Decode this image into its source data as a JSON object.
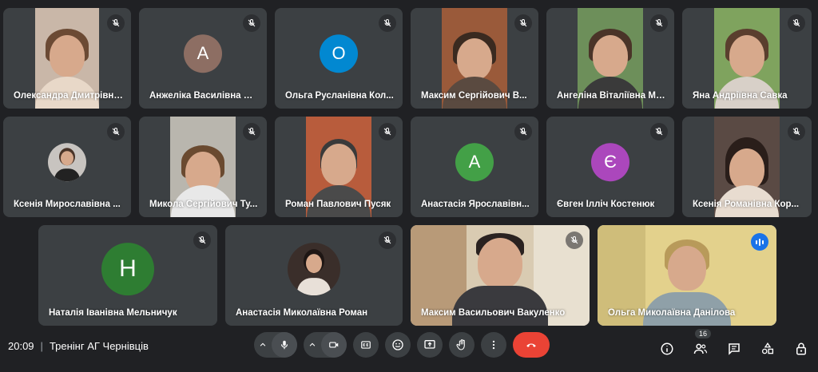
{
  "meeting": {
    "time": "20:09",
    "title": "Тренінг АГ Чернівців"
  },
  "participant_count": "16",
  "participants": [
    {
      "name": "Олександра Дмитрівна...",
      "type": "video",
      "muted": true
    },
    {
      "name": "Анжеліка Василівна Ш...",
      "type": "avatar",
      "initial": "А",
      "color": "#8d6e63",
      "muted": true
    },
    {
      "name": "Ольга Русланівна Кол...",
      "type": "avatar",
      "initial": "О",
      "color": "#0288d1",
      "muted": true
    },
    {
      "name": "Максим Сергійович В...",
      "type": "video",
      "muted": true
    },
    {
      "name": "Ангеліна Віталіївна Ма...",
      "type": "video",
      "muted": true
    },
    {
      "name": "Яна Андріївна Савка",
      "type": "video",
      "muted": true
    },
    {
      "name": "Ксенія Мирославівна ...",
      "type": "photo",
      "muted": true
    },
    {
      "name": "Микола Сергійович Ту...",
      "type": "video",
      "muted": true
    },
    {
      "name": "Роман Павлович Пусяк",
      "type": "video",
      "muted": true
    },
    {
      "name": "Анастасія Ярославівн...",
      "type": "avatar",
      "initial": "А",
      "color": "#43a047",
      "muted": true
    },
    {
      "name": "Євген Ілліч Костенюк",
      "type": "avatar",
      "initial": "Є",
      "color": "#ab47bc",
      "muted": true
    },
    {
      "name": "Ксенія Романівна Кор...",
      "type": "video",
      "muted": true
    },
    {
      "name": "Наталія Іванівна Мельничук",
      "type": "avatar",
      "initial": "Н",
      "color": "#2e7d32",
      "muted": true
    },
    {
      "name": "Анастасія Миколаївна Роман",
      "type": "photo",
      "muted": true
    },
    {
      "name": "Максим Васильович Вакуленко",
      "type": "video",
      "muted": true
    },
    {
      "name": "Ольга Миколаївна Данілова",
      "type": "video",
      "speaking": true
    }
  ],
  "icons": {
    "mic": "microphone-icon",
    "camera": "camera-icon",
    "captions": "captions-icon",
    "emoji": "emoji-icon",
    "present": "present-icon",
    "hand": "raise-hand-icon",
    "more": "more-vert-icon",
    "end": "end-call-icon",
    "info": "info-icon",
    "people": "people-icon",
    "chat": "chat-icon",
    "activities": "activities-icon",
    "host": "host-controls-icon"
  },
  "colors": {
    "background": "#202124",
    "tile": "#3c4043",
    "end_call": "#ea4335",
    "speaking": "#8ab4f8"
  }
}
